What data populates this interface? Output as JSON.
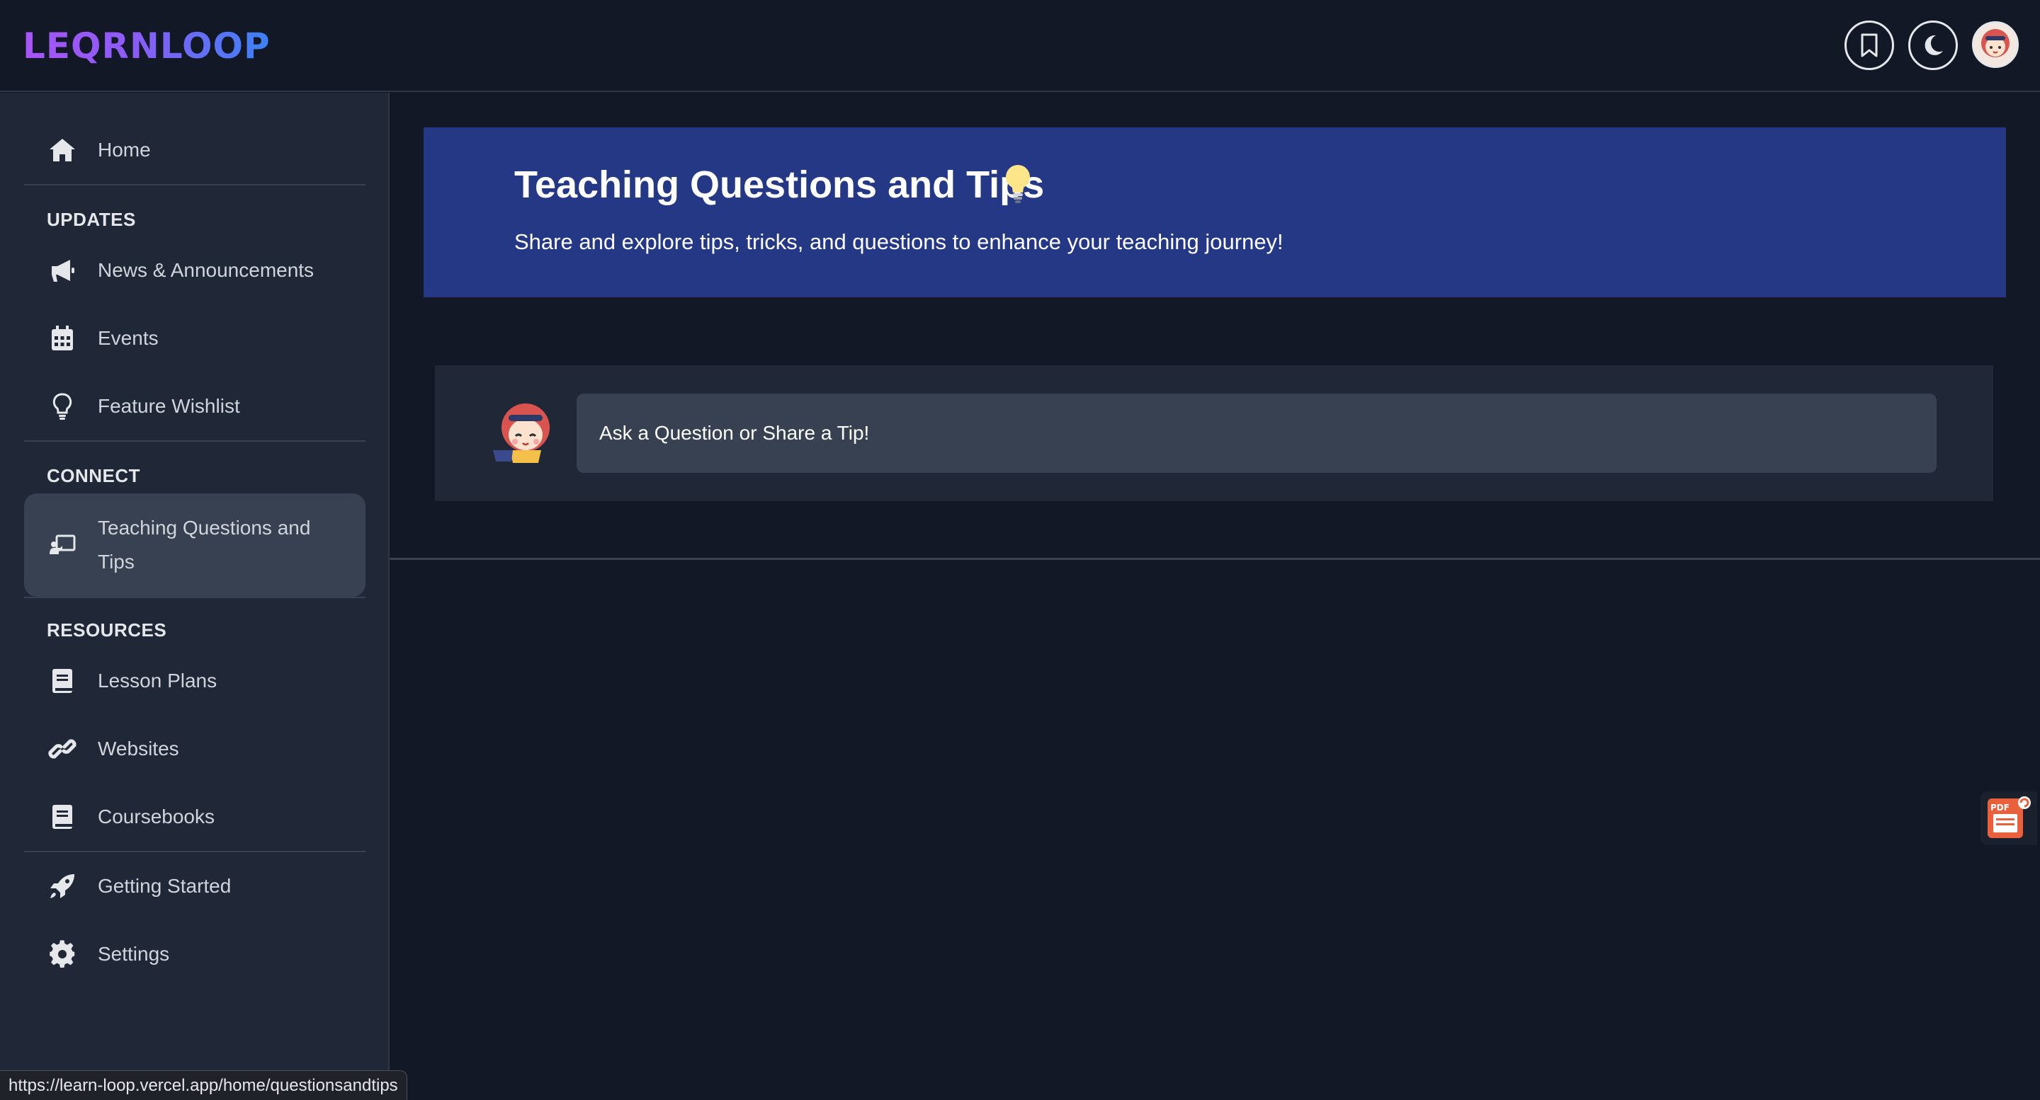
{
  "app": {
    "logo_text": "LEQRNLOOP"
  },
  "header": {
    "bookmark_icon": "bookmark-icon",
    "theme_icon": "moon-icon",
    "avatar_icon": "user-avatar"
  },
  "sidebar": {
    "home": "Home",
    "section_updates": "UPDATES",
    "news": "News & Announcements",
    "events": "Events",
    "feature_wishlist": "Feature Wishlist",
    "section_connect": "CONNECT",
    "teaching": "Teaching Questions and Tips",
    "section_resources": "RESOURCES",
    "lesson_plans": "Lesson Plans",
    "websites": "Websites",
    "coursebooks": "Coursebooks",
    "getting_started": "Getting Started",
    "settings": "Settings"
  },
  "banner": {
    "title": "Teaching Questions and Tips",
    "subtitle": "Share and explore tips, tricks, and questions to enhance your teaching journey!",
    "icon": "lightbulb-icon"
  },
  "composer": {
    "placeholder": "Ask a Question or Share a Tip!"
  },
  "floating": {
    "pdf_icon": "pdf-icon"
  },
  "status_bar": {
    "url": "https://learn-loop.vercel.app/home/questionsandtips"
  },
  "colors": {
    "background": "#121826",
    "sidebar": "#202736",
    "banner": "#253886",
    "active_item": "#374151",
    "logo_start": "#a855f7",
    "logo_end": "#3b82f6"
  }
}
